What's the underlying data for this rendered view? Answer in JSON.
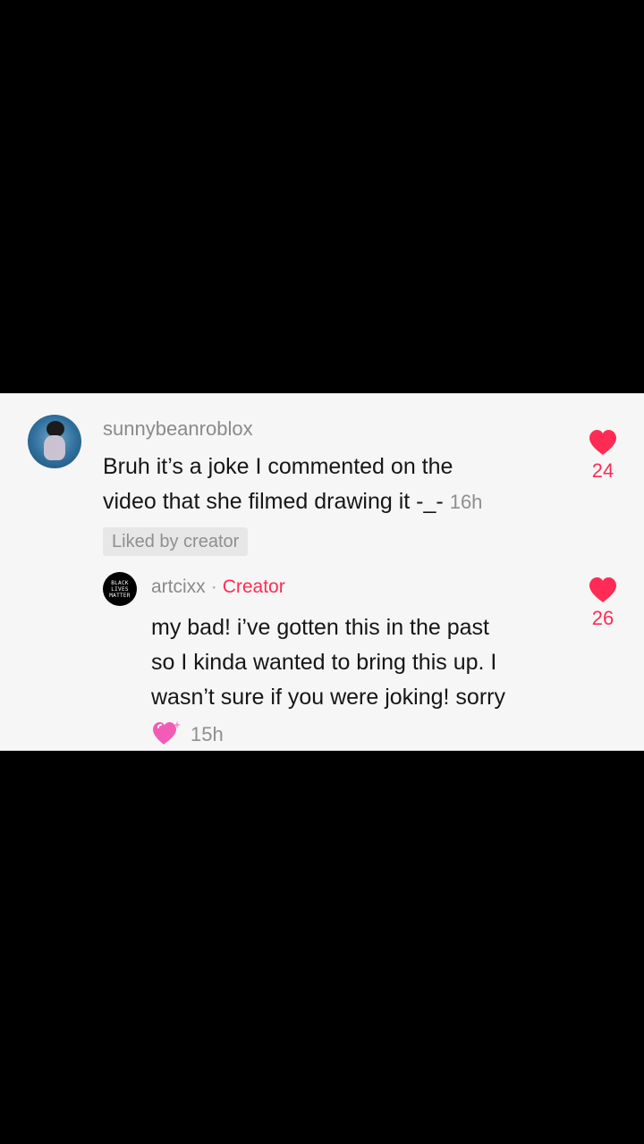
{
  "comment": {
    "username": "sunnybeanroblox",
    "text_line1": "Bruh it’s a joke I commented on the",
    "text_line2": "video that she filmed drawing it -_-",
    "timestamp": "16h",
    "liked_badge": "Liked by creator",
    "likes": "24"
  },
  "reply": {
    "username": "artcixx",
    "separator": "·",
    "creator_label": "Creator",
    "avatar_text": [
      "BLACK",
      "LIVES",
      "MATTER"
    ],
    "text_line1": "my bad! i’ve gotten this in the past",
    "text_line2": "so I kinda wanted to bring this up. I",
    "text_line3": "wasn’t sure if you were joking! sorry",
    "emoji": "heart-sparkle-emoji",
    "timestamp": "15h",
    "likes": "26"
  },
  "colors": {
    "accent": "#fe2c55",
    "panel_bg": "#f6f6f6",
    "letterbox": "#000000"
  }
}
